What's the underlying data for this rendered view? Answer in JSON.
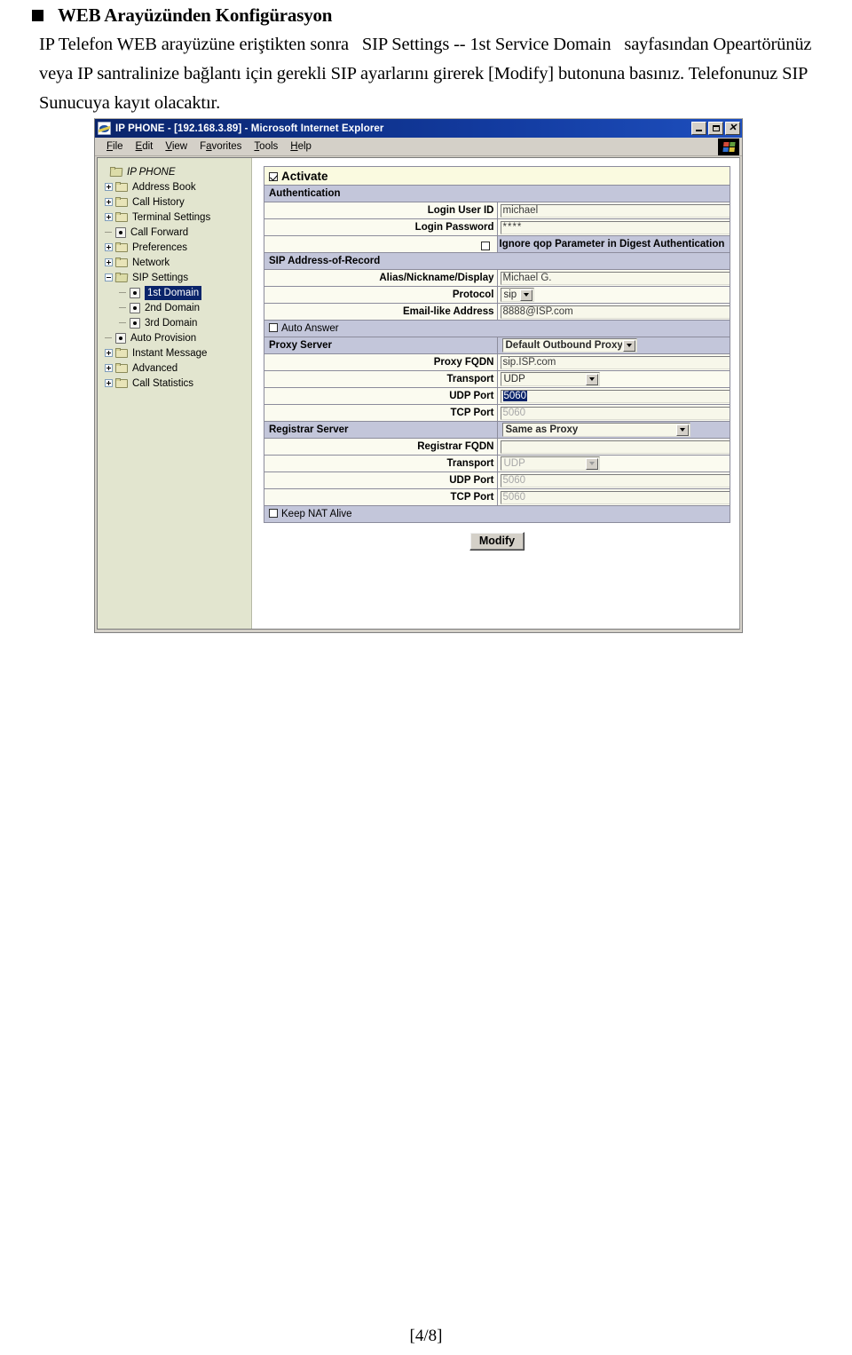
{
  "document": {
    "heading": "WEB Arayüzünden Konfigürasyon",
    "paragraph": "IP Telefon WEB arayüzüne eriştikten sonra   SIP Settings -- 1st Service Domain   sayfasından Opeartörünüz veya IP santralinize bağlantı için gerekli SIP ayarlarını girerek [Modify] butonuna basınız. Telefonunuz SIP Sunucuya kayıt olacaktır.",
    "footer": "[4/8]"
  },
  "browser": {
    "title": "IP PHONE - [192.168.3.89] - Microsoft Internet Explorer",
    "window_controls": {
      "minimize": "minimize",
      "maximize": "maximize",
      "close": "close"
    },
    "menu": [
      {
        "label": "File"
      },
      {
        "label": "Edit"
      },
      {
        "label": "View"
      },
      {
        "label": "Favorites"
      },
      {
        "label": "Tools"
      },
      {
        "label": "Help"
      }
    ]
  },
  "tree": {
    "items": [
      {
        "label": "IP PHONE",
        "level": 0,
        "icon": "folder-open-icon",
        "expander": "none",
        "selected": false,
        "root": true
      },
      {
        "label": "Address Book",
        "level": 1,
        "icon": "folder-icon",
        "expander": "plus",
        "selected": false
      },
      {
        "label": "Call History",
        "level": 1,
        "icon": "folder-icon",
        "expander": "plus",
        "selected": false
      },
      {
        "label": "Terminal Settings",
        "level": 1,
        "icon": "folder-icon",
        "expander": "plus",
        "selected": false
      },
      {
        "label": "Call Forward",
        "level": 1,
        "icon": "page-icon",
        "expander": "dash",
        "selected": false
      },
      {
        "label": "Preferences",
        "level": 1,
        "icon": "folder-icon",
        "expander": "plus",
        "selected": false
      },
      {
        "label": "Network",
        "level": 1,
        "icon": "folder-icon",
        "expander": "plus",
        "selected": false
      },
      {
        "label": "SIP Settings",
        "level": 1,
        "icon": "folder-open-icon",
        "expander": "minus",
        "selected": false
      },
      {
        "label": "1st Domain",
        "level": 2,
        "icon": "page-icon",
        "expander": "dash",
        "selected": true
      },
      {
        "label": "2nd Domain",
        "level": 2,
        "icon": "page-icon",
        "expander": "dash",
        "selected": false
      },
      {
        "label": "3rd Domain",
        "level": 2,
        "icon": "page-icon",
        "expander": "dash",
        "selected": false
      },
      {
        "label": "Auto Provision",
        "level": 1,
        "icon": "page-icon",
        "expander": "dash",
        "selected": false
      },
      {
        "label": "Instant Message",
        "level": 1,
        "icon": "folder-icon",
        "expander": "plus",
        "selected": false
      },
      {
        "label": "Advanced",
        "level": 1,
        "icon": "folder-icon",
        "expander": "plus",
        "selected": false
      },
      {
        "label": "Call Statistics",
        "level": 1,
        "icon": "folder-icon",
        "expander": "plus",
        "selected": false
      }
    ]
  },
  "form": {
    "activate": {
      "label": "Activate",
      "checked": true
    },
    "sections": {
      "authentication": "Authentication",
      "sip_aor": "SIP Address-of-Record",
      "proxy_server": "Proxy Server",
      "registrar_server": "Registrar Server"
    },
    "fields": {
      "login_user_id": {
        "label": "Login User ID",
        "value": "michael"
      },
      "login_password": {
        "label": "Login Password",
        "value": "****"
      },
      "ignore_qop": {
        "label": "Ignore qop Parameter in Digest Authentication",
        "checked": false
      },
      "alias": {
        "label": "Alias/Nickname/Display",
        "value": "Michael G."
      },
      "protocol": {
        "label": "Protocol",
        "value": "sip"
      },
      "email_like": {
        "label": "Email-like Address",
        "value": "8888@ISP.com"
      },
      "auto_answer": {
        "label": "Auto Answer",
        "checked": false
      },
      "proxy_mode": {
        "value": "Default Outbound Proxy"
      },
      "proxy_fqdn": {
        "label": "Proxy FQDN",
        "value": "sip.ISP.com"
      },
      "proxy_transport": {
        "label": "Transport",
        "value": "UDP"
      },
      "proxy_udp_port": {
        "label": "UDP Port",
        "value": "5060",
        "selected_text": true
      },
      "proxy_tcp_port": {
        "label": "TCP Port",
        "value": "5060",
        "disabled": true
      },
      "registrar_mode": {
        "value": "Same as Proxy"
      },
      "registrar_fqdn": {
        "label": "Registrar FQDN",
        "value": ""
      },
      "reg_transport": {
        "label": "Transport",
        "value": "UDP",
        "disabled": true
      },
      "reg_udp_port": {
        "label": "UDP Port",
        "value": "5060",
        "disabled": true
      },
      "reg_tcp_port": {
        "label": "TCP Port",
        "value": "5060",
        "disabled": true
      },
      "keep_nat_alive": {
        "label": "Keep NAT Alive",
        "checked": false
      }
    },
    "modify_button": "Modify"
  },
  "colors": {
    "titlebar": "#0a246a",
    "tree_pane": "#e2e5cf",
    "section_header": "#c3c6da",
    "field_bg": "#fbfbf0",
    "activate_bg": "#fafae0",
    "selection": "#0a246a",
    "chrome": "#d4d0c8"
  }
}
